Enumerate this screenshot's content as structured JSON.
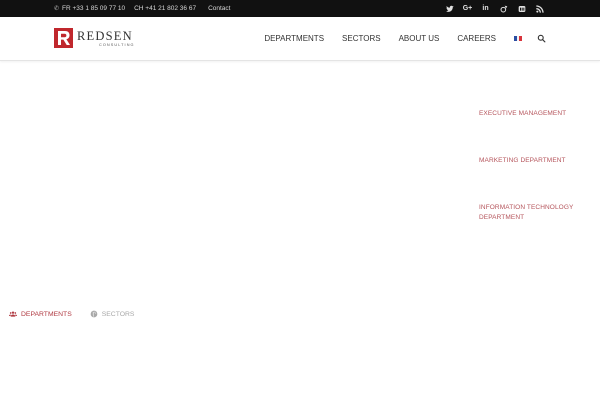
{
  "topbar": {
    "phone_fr": "FR +33 1 85 09 77 10",
    "phone_ch": "CH +41 21 802 36 67",
    "contact_label": "Contact",
    "social_icons": [
      "twitter-icon",
      "google-plus-icon",
      "linkedin-icon",
      "viadeo-icon",
      "meetup-icon",
      "rss-icon"
    ]
  },
  "brand": {
    "name": "REDSEN",
    "tagline": "CONSULTING",
    "color": "#c0272d"
  },
  "nav": {
    "items": [
      "DEPARTMENTS",
      "SECTORS",
      "ABOUT US",
      "CAREERS"
    ],
    "language_flag": "french-flag-icon",
    "search_icon": "search-icon"
  },
  "side_links": {
    "executive": "EXECUTIVE MANAGEMENT",
    "marketing": "MARKETING DEPARTMENT",
    "it_line1": "INFORMATION TECHNOLOGY",
    "it_line2": "DEPARTMENT",
    "color": "#b5545b"
  },
  "tabs": {
    "departments": "DEPARTMENTS",
    "sectors": "SECTORS",
    "active": "DEPARTMENTS",
    "active_color": "#b03a42"
  }
}
